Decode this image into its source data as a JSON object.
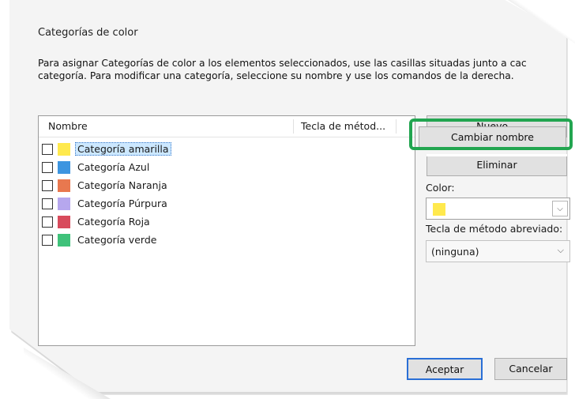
{
  "dialog": {
    "title": "Categorías de color",
    "instructions": [
      "Para asignar Categorías de color a los elementos seleccionados, use las casillas situadas junto a cac",
      "categoría. Para modificar una categoría, seleccione su nombre y use los comandos de la derecha."
    ]
  },
  "list": {
    "headers": {
      "name": "Nombre",
      "shortcut": "Tecla de métod..."
    },
    "items": [
      {
        "label": "Categoría amarilla",
        "color": "#ffe94d",
        "checked": false,
        "selected": true
      },
      {
        "label": "Categoría Azul",
        "color": "#3d95e0",
        "checked": false,
        "selected": false
      },
      {
        "label": "Categoría Naranja",
        "color": "#e8784f",
        "checked": false,
        "selected": false
      },
      {
        "label": "Categoría Púrpura",
        "color": "#b6a7ee",
        "checked": false,
        "selected": false
      },
      {
        "label": "Categoría Roja",
        "color": "#d84b5c",
        "checked": false,
        "selected": false
      },
      {
        "label": "Categoría verde",
        "color": "#3fc27a",
        "checked": false,
        "selected": false
      }
    ]
  },
  "buttons": {
    "nuevo": "Nuevo...",
    "cambiar_nombre": "Cambiar nombre",
    "eliminar": "Eliminar",
    "aceptar": "Aceptar",
    "cancelar": "Cancelar"
  },
  "color": {
    "label": "Color:",
    "selected_color": "#ffe94d",
    "arrow_icon": "chevron-down-icon"
  },
  "shortcut": {
    "label": "Tecla de método abreviado:",
    "value": "(ninguna)"
  },
  "highlight_color": "#22a550"
}
